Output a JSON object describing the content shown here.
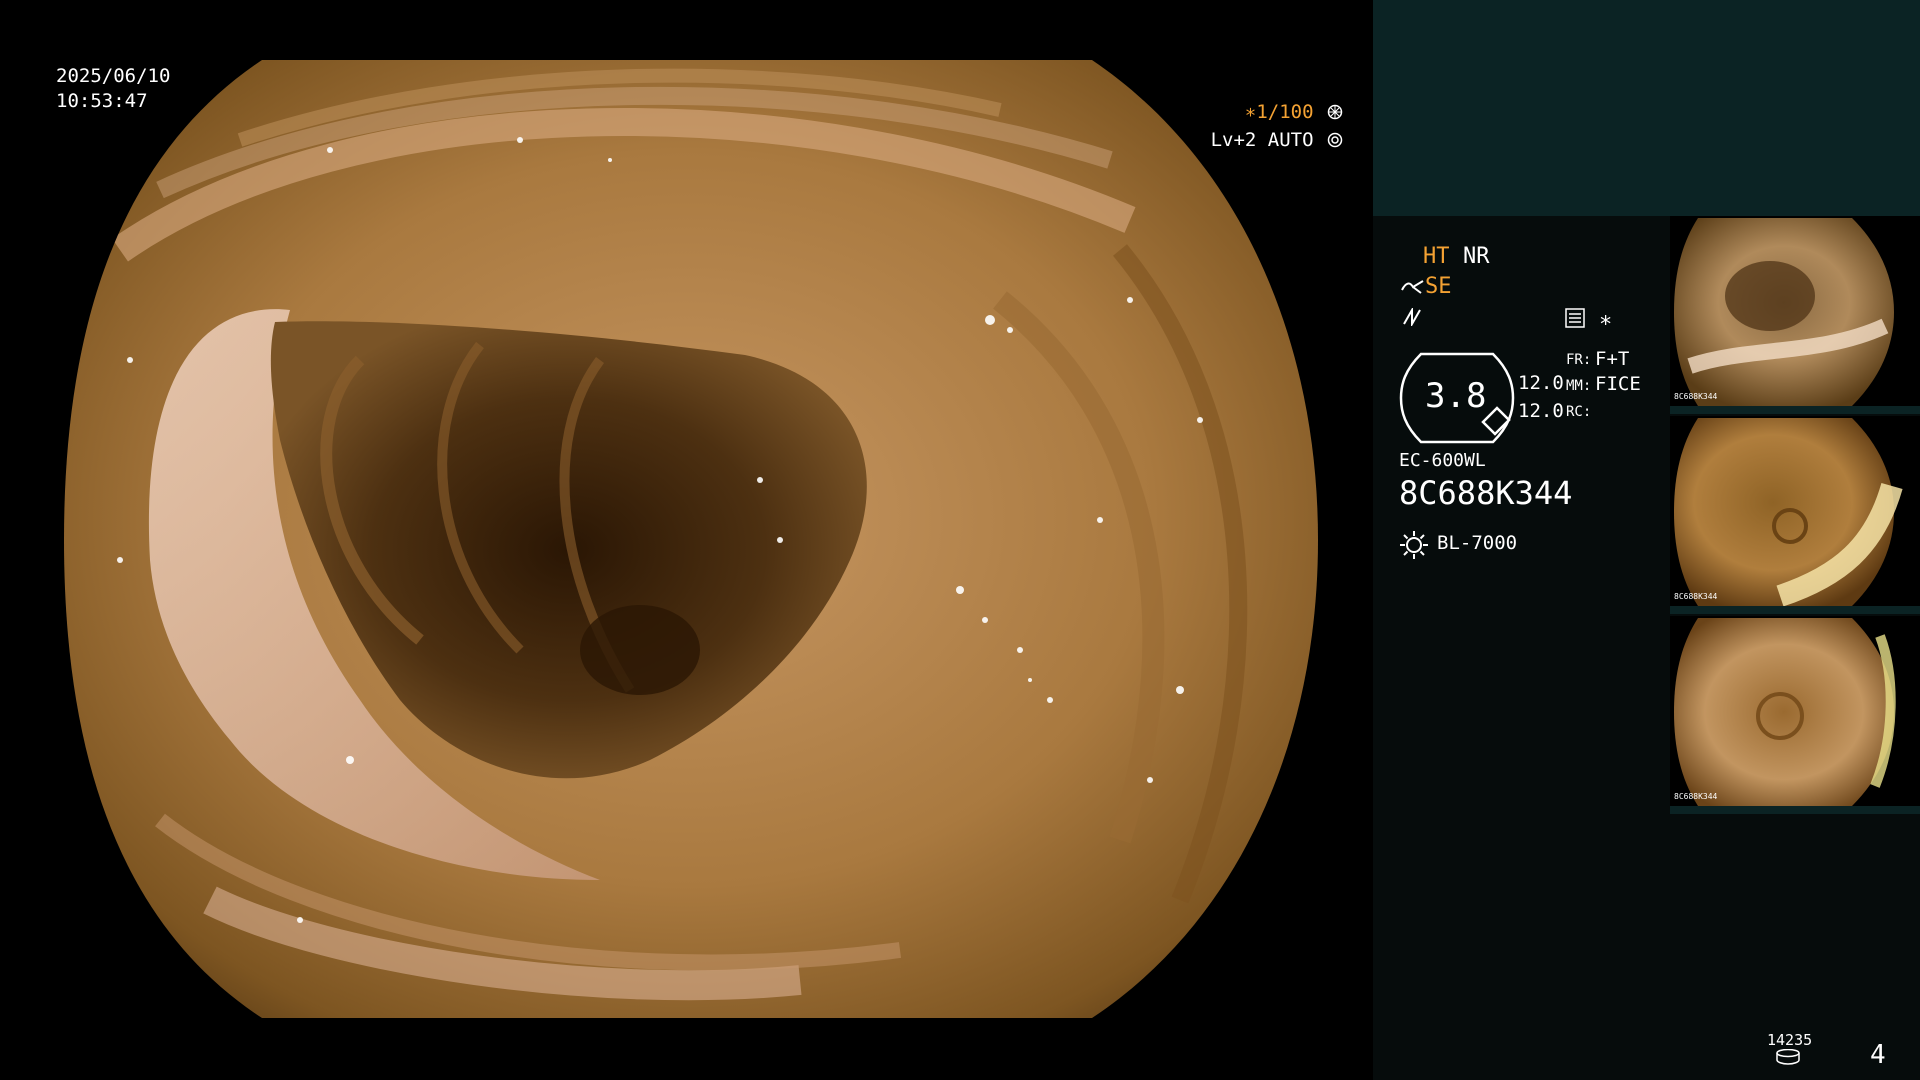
{
  "datetime": {
    "date": "2025/06/10",
    "time": "10:53:47"
  },
  "shutter": {
    "speed": "∗1/100",
    "level": "Lv+2 AUTO"
  },
  "settings": {
    "ht": "HT",
    "nr": "NR",
    "se": "SE",
    "zoom_value": "3.8",
    "val1": "12.0",
    "val2": "12.0",
    "fr_label": "FR:",
    "fr_value": "F+T",
    "mm_label": "MM:",
    "mm_value": "FICE",
    "rc_label": "RC:",
    "rc_value": ""
  },
  "device": {
    "model": "EC-600WL",
    "serial": "8C688K344",
    "light_source": "BL-7000"
  },
  "storage": {
    "count": "14235",
    "page": "4"
  },
  "colors": {
    "accent_orange": "#f4a233",
    "panel_teal": "#0b2324",
    "panel_dark": "#060c0c"
  },
  "thumbnails": [
    {
      "serial": "8C688K344"
    },
    {
      "serial": "8C688K344"
    },
    {
      "serial": "8C688K344"
    }
  ]
}
